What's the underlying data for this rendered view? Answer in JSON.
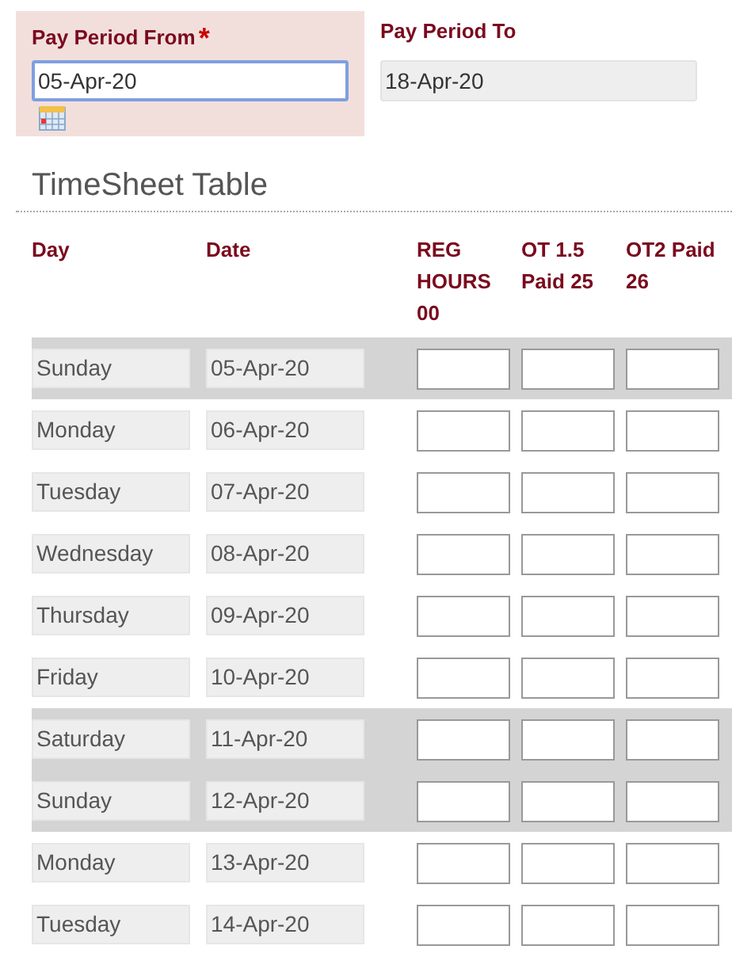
{
  "pay_period_from": {
    "label": "Pay Period From",
    "required_mark": "*",
    "value": "05-Apr-20"
  },
  "pay_period_to": {
    "label": "Pay Period To",
    "value": "18-Apr-20"
  },
  "table": {
    "title": "TimeSheet Table",
    "columns": [
      "Day",
      "Date",
      "REG HOURS 00",
      "OT 1.5 Paid 25",
      "OT2 Paid 26"
    ],
    "rows": [
      {
        "day": "Sunday",
        "date": "05-Apr-20",
        "weekend": true
      },
      {
        "day": "Monday",
        "date": "06-Apr-20",
        "weekend": false
      },
      {
        "day": "Tuesday",
        "date": "07-Apr-20",
        "weekend": false
      },
      {
        "day": "Wednesday",
        "date": "08-Apr-20",
        "weekend": false
      },
      {
        "day": "Thursday",
        "date": "09-Apr-20",
        "weekend": false
      },
      {
        "day": "Friday",
        "date": "10-Apr-20",
        "weekend": false
      },
      {
        "day": "Saturday",
        "date": "11-Apr-20",
        "weekend": true
      },
      {
        "day": "Sunday",
        "date": "12-Apr-20",
        "weekend": true
      },
      {
        "day": "Monday",
        "date": "13-Apr-20",
        "weekend": false
      },
      {
        "day": "Tuesday",
        "date": "14-Apr-20",
        "weekend": false
      }
    ]
  }
}
